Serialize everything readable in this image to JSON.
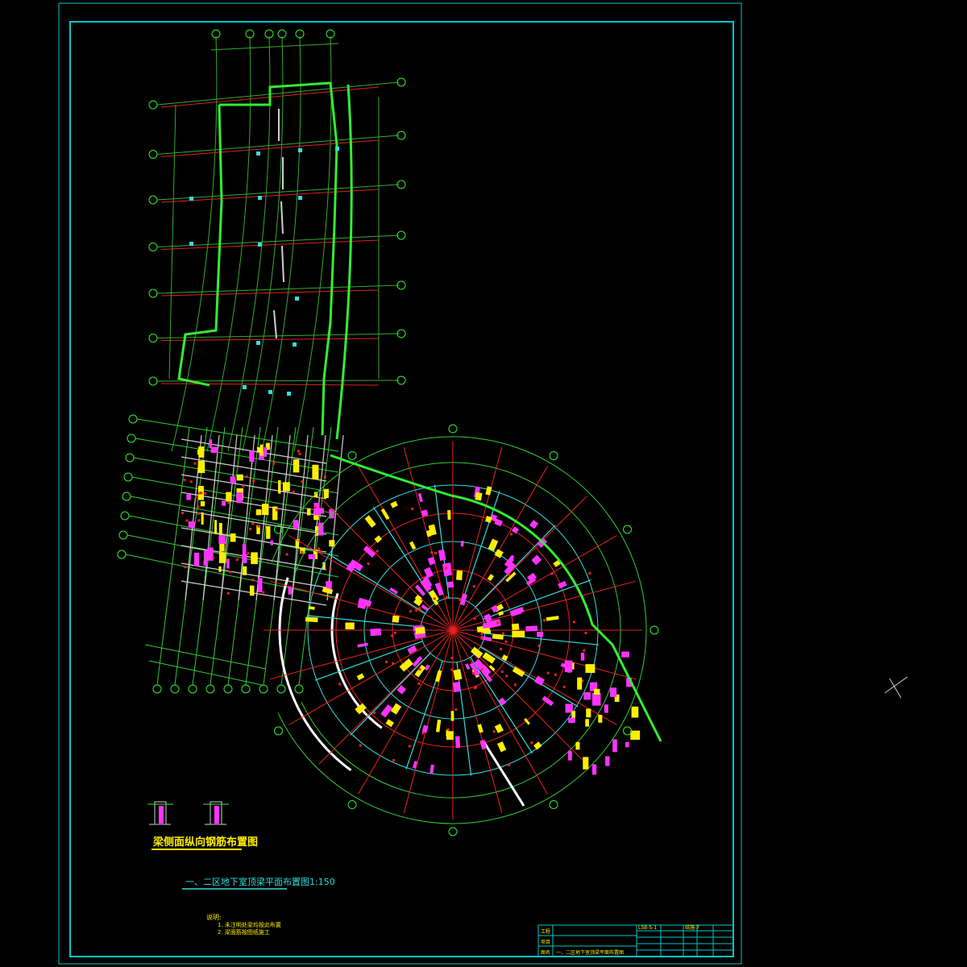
{
  "drawing": {
    "sub_title": "梁侧面纵向钢筋布置图",
    "main_title": "一、二区地下室顶梁平面布置图1:150",
    "notes_heading": "说明:",
    "notes": [
      "1. 未注明处梁均按此布置",
      "2. 梁面筋按图纸施工"
    ]
  },
  "title_block": {
    "sheet_name": "一、二区地下室顶梁平面布置图",
    "drawing_no": "LSB-S-1",
    "sheet_id": "结施-7",
    "row_labels": [
      "工程",
      "项目",
      "图名"
    ]
  },
  "colors": {
    "frame": "#00c8c8",
    "wall": "#33ee33",
    "grid": "#ee2222",
    "beam": "#cfcfcf",
    "tag_magenta": "#ff33ff",
    "tag_yellow": "#ffee00",
    "cyan": "#33dddd"
  }
}
